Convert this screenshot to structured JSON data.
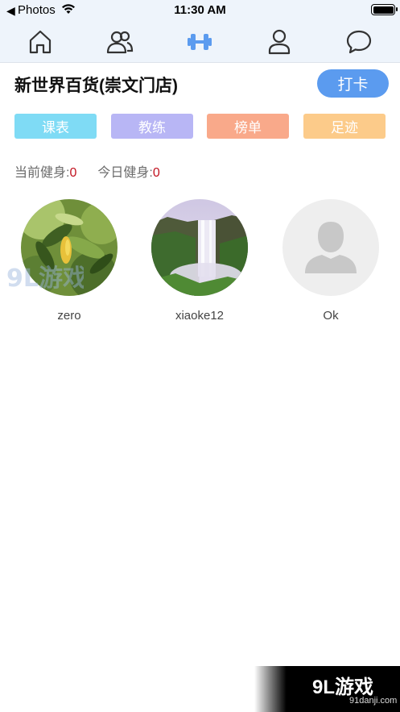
{
  "status_bar": {
    "back_app": "Photos",
    "time": "11:30 AM",
    "battery_level": 1.0
  },
  "nav": {
    "items": [
      {
        "icon": "home-icon"
      },
      {
        "icon": "group-icon"
      },
      {
        "icon": "dumbbell-icon",
        "active": true
      },
      {
        "icon": "profile-icon"
      },
      {
        "icon": "chat-bubble-icon"
      }
    ],
    "active_color": "#5b9bef",
    "inactive_color": "#333333"
  },
  "store": {
    "name": "新世界百货(崇文门店)",
    "checkin_label": "打卡"
  },
  "categories": [
    {
      "label": "课表",
      "color": "#7fdbf5"
    },
    {
      "label": "教练",
      "color": "#b8b6f5"
    },
    {
      "label": "榜单",
      "color": "#f9a98a"
    },
    {
      "label": "足迹",
      "color": "#fccb8a"
    }
  ],
  "stats": {
    "current_label": "当前健身:",
    "current_value": "0",
    "today_label": "今日健身:",
    "today_value": "0"
  },
  "members": [
    {
      "name": "zero",
      "avatar": "leaves-photo"
    },
    {
      "name": "xiaoke12",
      "avatar": "waterfall-photo"
    },
    {
      "name": "Ok",
      "avatar": "default-user-icon"
    }
  ],
  "watermark": {
    "logo": "9L游戏",
    "site": "91danji.com",
    "avatar_mark": "9L游戏"
  }
}
